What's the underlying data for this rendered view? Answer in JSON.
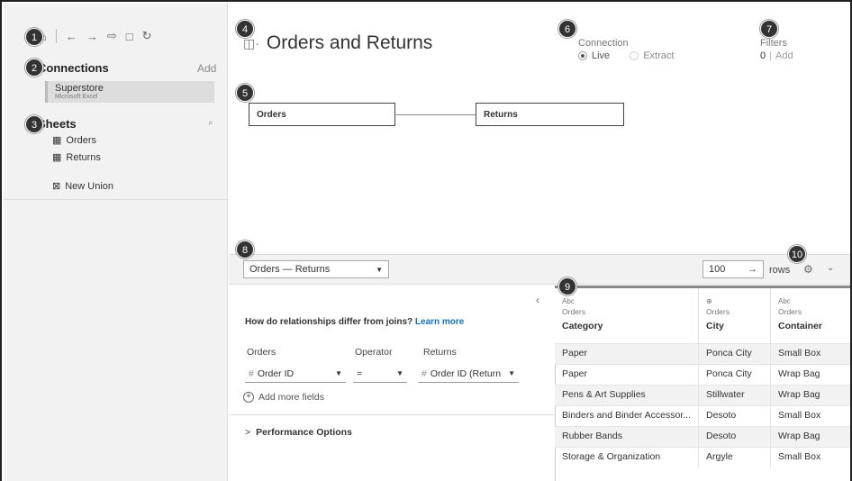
{
  "badges": [
    "1",
    "2",
    "3",
    "4",
    "5",
    "6",
    "7",
    "8",
    "9",
    "10"
  ],
  "toolbar": {
    "home_icon": "⌂",
    "back_icon": "←",
    "forward_icon": "→",
    "redirect_icon": "⇨",
    "save_icon": "□",
    "refresh_icon": "↻"
  },
  "connections": {
    "title": "Connections",
    "add": "Add",
    "item_name": "Superstore",
    "item_type": "Microsoft Excel"
  },
  "sheets": {
    "title": "Sheets",
    "search_icon": "⌕",
    "items": [
      "Orders",
      "Returns"
    ],
    "new_union": "New Union"
  },
  "header": {
    "title": "Orders and Returns",
    "connection_label": "Connection",
    "live": "Live",
    "extract": "Extract",
    "filters_label": "Filters",
    "filters_count": "0",
    "filters_add": "Add"
  },
  "canvas": {
    "left_table": "Orders",
    "right_table": "Returns"
  },
  "bottom": {
    "relationship_select": "Orders  —  Returns",
    "rows_value": "100",
    "rows_label": "rows",
    "question": "How do relationships differ from joins?",
    "learn_more": "Learn more",
    "col_left": "Orders",
    "col_op": "Operator",
    "col_right": "Returns",
    "field_left": "Order ID",
    "field_op": "=",
    "field_right": "Order ID (Return",
    "add_more": "Add more fields",
    "performance": "Performance Options"
  },
  "grid": {
    "columns": [
      {
        "type": "Abc",
        "source": "Orders",
        "name": "Category"
      },
      {
        "type": "⊕",
        "source": "Orders",
        "name": "City"
      },
      {
        "type": "Abc",
        "source": "Orders",
        "name": "Container"
      }
    ],
    "rows": [
      [
        "Paper",
        "Ponca City",
        "Small Box"
      ],
      [
        "Paper",
        "Ponca City",
        "Wrap Bag"
      ],
      [
        "Pens & Art Supplies",
        "Stillwater",
        "Wrap Bag"
      ],
      [
        "Binders and Binder Accessor...",
        "Desoto",
        "Small Box"
      ],
      [
        "Rubber Bands",
        "Desoto",
        "Wrap Bag"
      ],
      [
        "Storage & Organization",
        "Argyle",
        "Small Box"
      ]
    ]
  }
}
